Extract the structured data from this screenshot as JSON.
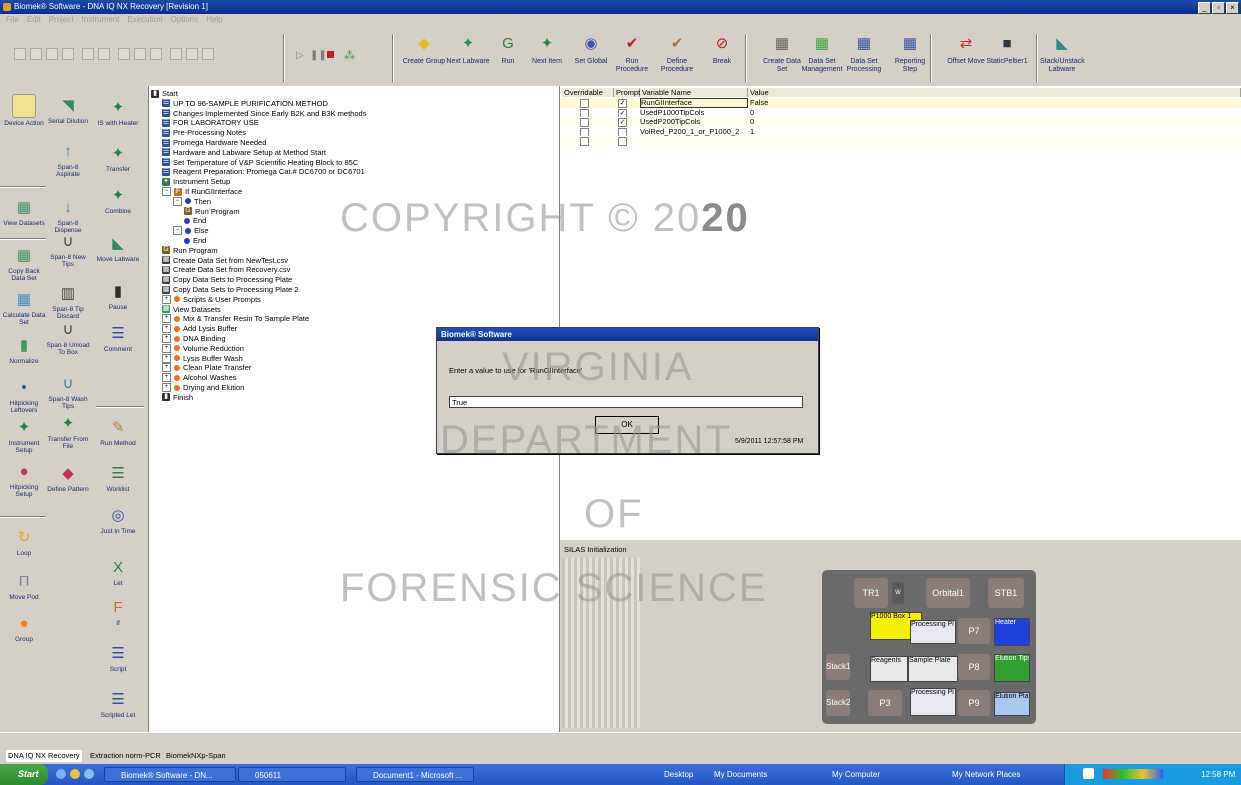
{
  "window": {
    "title": "Biomek® Software - DNA IQ NX Recovery [Revision 1]",
    "controls": [
      "_",
      "▫",
      "×"
    ]
  },
  "menu": [
    "File",
    "Edit",
    "Project",
    "Instrument",
    "Execution",
    "Options",
    "Help"
  ],
  "toolbar": {
    "buttons": [
      {
        "label": "Create Group",
        "icon": "create-group-icon",
        "color": "#e0c020"
      },
      {
        "label": "Next Labware",
        "icon": "next-labware-icon",
        "color": "#2c8a4a"
      },
      {
        "label": "Run",
        "icon": "run-icon",
        "color": "#2a8040"
      },
      {
        "label": "Next Item",
        "icon": "next-item-icon",
        "color": "#2a8040"
      },
      {
        "label": "Set Global",
        "icon": "set-global-icon",
        "color": "#4050b8"
      },
      {
        "label": "Run Procedure",
        "icon": "run-procedure-icon",
        "color": "#c02020"
      },
      {
        "label": "Define Procedure",
        "icon": "define-procedure-icon",
        "color": "#c07030"
      },
      {
        "label": "Break",
        "icon": "break-icon",
        "color": "#c02020"
      },
      {
        "label": "Create Data Set",
        "icon": "create-data-set-icon",
        "color": "#606060"
      },
      {
        "label": "Data Set Management",
        "icon": "data-set-management-icon",
        "color": "#40a040"
      },
      {
        "label": "Data Set Processing",
        "icon": "data-set-processing-icon",
        "color": "#3050a0"
      },
      {
        "label": "Reporting Step",
        "icon": "reporting-step-icon",
        "color": "#3050a0"
      },
      {
        "label": "Offset Move",
        "icon": "offset-move-icon",
        "color": "#d03020"
      },
      {
        "label": "StaticPeltier1",
        "icon": "static-peltier-icon",
        "color": "#303840"
      },
      {
        "label": "Stack/Unstack Labware",
        "icon": "stack-unstack-icon",
        "color": "#2a8a8a"
      }
    ]
  },
  "palette": {
    "col1": [
      {
        "label": "Device Action",
        "icon": "device-action-icon",
        "color": "#f0e090"
      },
      {
        "label": "View Datasets",
        "icon": "view-datasets-icon",
        "color": "#3a9a5a"
      },
      {
        "label": "Copy Back Data Set",
        "icon": "copy-back-icon",
        "color": "#3a9a5a"
      },
      {
        "label": "Calculate Data Set",
        "icon": "calculate-icon",
        "color": "#3a8ac0"
      },
      {
        "label": "Normalize",
        "icon": "normalize-icon",
        "color": "#3a9a5a"
      },
      {
        "label": "Hitpicking Leftovers",
        "icon": "hitpicking-leftovers-icon",
        "color": "#3050a0"
      },
      {
        "label": "Instrument Setup",
        "icon": "instrument-setup-icon",
        "color": "#2a8040"
      },
      {
        "label": "Hitpicking Setup",
        "icon": "hitpicking-setup-icon",
        "color": "#c03060"
      },
      {
        "label": "Loop",
        "icon": "loop-icon",
        "color": "#f0a020"
      },
      {
        "label": "Move Pod",
        "icon": "move-pod-icon",
        "color": "#8080a0"
      },
      {
        "label": "Group",
        "icon": "group-icon",
        "color": "#f08020"
      }
    ],
    "col2": [
      {
        "label": "Serial Dilution",
        "icon": "serial-dilution-icon",
        "color": "#2a8a6a"
      },
      {
        "label": "Span-8 Aspirate",
        "icon": "span8-aspirate-icon",
        "color": "#3a7aa0"
      },
      {
        "label": "Span-8 Dispense",
        "icon": "span8-dispense-icon",
        "color": "#3a7aa0"
      },
      {
        "label": "Span-8 New Tips",
        "icon": "span8-new-tips-icon",
        "color": "#404040"
      },
      {
        "label": "Span-8 Tip Discard",
        "icon": "span8-tip-discard-icon",
        "color": "#404040"
      },
      {
        "label": "Span-8 Unload To Box",
        "icon": "span8-unload-icon",
        "color": "#404040"
      },
      {
        "label": "Span-8 Wash Tips",
        "icon": "span8-wash-icon",
        "color": "#3a7aa0"
      },
      {
        "label": "Transfer From File",
        "icon": "transfer-from-file-icon",
        "color": "#2a8040"
      },
      {
        "label": "Define Pattern",
        "icon": "define-pattern-icon",
        "color": "#c03060"
      }
    ],
    "col3": [
      {
        "label": "IS with Heater",
        "icon": "is-heater-icon",
        "color": "#2a8040"
      },
      {
        "label": "Transfer",
        "icon": "transfer-icon",
        "color": "#2a8040"
      },
      {
        "label": "Combine",
        "icon": "combine-icon",
        "color": "#2a8040"
      },
      {
        "label": "Move Labware",
        "icon": "move-labware-icon",
        "color": "#2a8a6a"
      },
      {
        "label": "Pause",
        "icon": "pause-icon",
        "color": "#303030"
      },
      {
        "label": "Comment",
        "icon": "comment-icon",
        "color": "#3050a0"
      },
      {
        "label": "Run Method",
        "icon": "run-method-icon",
        "color": "#b08040"
      },
      {
        "label": "Worklist",
        "icon": "worklist-icon",
        "color": "#2a8040"
      },
      {
        "label": "Just In Time",
        "icon": "just-in-time-icon",
        "color": "#3050a0"
      },
      {
        "label": "Let",
        "icon": "let-icon",
        "color": "#2a8040"
      },
      {
        "label": "If",
        "icon": "if-icon",
        "color": "#c07030"
      },
      {
        "label": "Script",
        "icon": "script-icon",
        "color": "#3050a0"
      },
      {
        "label": "Scripted Let",
        "icon": "scripted-let-icon",
        "color": "#3050a0"
      }
    ]
  },
  "tree": [
    {
      "label": "Start",
      "indent": 0,
      "kind": "start"
    },
    {
      "label": "UP TO 96-SAMPLE PURIFICATION METHOD",
      "indent": 1,
      "kind": "comment"
    },
    {
      "label": "Changes Implemented Since Early B2K and B3K methods",
      "indent": 1,
      "kind": "comment"
    },
    {
      "label": "FOR LABORATORY USE",
      "indent": 1,
      "kind": "comment"
    },
    {
      "label": "Pre-Processing Notes",
      "indent": 1,
      "kind": "comment"
    },
    {
      "label": "Promega Hardware Needed",
      "indent": 1,
      "kind": "comment"
    },
    {
      "label": "Hardware and Labware Setup at Method Start",
      "indent": 1,
      "kind": "comment"
    },
    {
      "label": "Set Temperature of V&P Scientific Heating Block to 85C",
      "indent": 1,
      "kind": "comment"
    },
    {
      "label": "Reagent Preparation:  Promega Cat.# DC6700 or DC6701",
      "indent": 1,
      "kind": "comment"
    },
    {
      "label": "Instrument Setup",
      "indent": 1,
      "kind": "setup"
    },
    {
      "label": "If RunGIInterface",
      "indent": 1,
      "kind": "if"
    },
    {
      "label": "Then",
      "indent": 2,
      "kind": "branch"
    },
    {
      "label": "Run Program",
      "indent": 3,
      "kind": "run"
    },
    {
      "label": "End",
      "indent": 3,
      "kind": "end"
    },
    {
      "label": "Else",
      "indent": 2,
      "kind": "branch"
    },
    {
      "label": "End",
      "indent": 3,
      "kind": "end"
    },
    {
      "label": "Run Program",
      "indent": 1,
      "kind": "run"
    },
    {
      "label": "Create Data Set from NewTest.csv",
      "indent": 1,
      "kind": "data"
    },
    {
      "label": "Create Data Set from Recovery.csv",
      "indent": 1,
      "kind": "data"
    },
    {
      "label": "Copy Data Sets to Processing Plate",
      "indent": 1,
      "kind": "copy"
    },
    {
      "label": "Copy Data Sets to Processing Plate 2",
      "indent": 1,
      "kind": "copy"
    },
    {
      "label": "Scripts & User Prompts",
      "indent": 1,
      "kind": "group"
    },
    {
      "label": "View Datasets",
      "indent": 1,
      "kind": "view"
    },
    {
      "label": "Mix & Transfer Resin To Sample Plate",
      "indent": 1,
      "kind": "group"
    },
    {
      "label": "Add Lysis Buffer",
      "indent": 1,
      "kind": "group"
    },
    {
      "label": "DNA Binding",
      "indent": 1,
      "kind": "group"
    },
    {
      "label": "Volume Reduction",
      "indent": 1,
      "kind": "group"
    },
    {
      "label": "Lysis Buffer Wash",
      "indent": 1,
      "kind": "group"
    },
    {
      "label": "Clean Plate Transfer",
      "indent": 1,
      "kind": "group"
    },
    {
      "label": "Alcohol Washes",
      "indent": 1,
      "kind": "group"
    },
    {
      "label": "Drying and Elution",
      "indent": 1,
      "kind": "group"
    },
    {
      "label": "Finish",
      "indent": 1,
      "kind": "finish"
    }
  ],
  "variables": {
    "headers": [
      "Overridable",
      "Prompt",
      "Variable Name",
      "Value"
    ],
    "rows": [
      {
        "overridable": false,
        "prompt": true,
        "name": "RunGIInterface",
        "value": "False"
      },
      {
        "overridable": false,
        "prompt": true,
        "name": "UsedP1000TipCols",
        "value": "0"
      },
      {
        "overridable": false,
        "prompt": true,
        "name": "UsedP200TipCols",
        "value": "0"
      },
      {
        "overridable": false,
        "prompt": false,
        "name": "VolRed_P200_1_or_P1000_2",
        "value": "1"
      },
      {
        "overridable": false,
        "prompt": false,
        "name": "",
        "value": ""
      }
    ]
  },
  "deck": {
    "title": "SILAS Initialization",
    "positions": [
      "TR1",
      "Orbital1",
      "STB1",
      "P7",
      "P8",
      "P3",
      "P9",
      "Stack1",
      "Stack2"
    ],
    "labware": [
      "P1000 Box 1",
      "Processing Pl",
      "Heater",
      "Reagents",
      "Sample Plate",
      "Elution Tips",
      "Processing Pl",
      "Elution Plate"
    ],
    "misc": "W"
  },
  "dialog": {
    "title": "Biomek® Software",
    "prompt": "Enter a value to use for 'RunGIInterface'",
    "value": "True",
    "ok": "OK",
    "timestamp": "5/9/2011 12:57:58 PM"
  },
  "watermark": {
    "line1": "COPYRIGHT © 20",
    "line1b": "20",
    "line2": "VIRGINIA",
    "line3": "DEPARTMENT",
    "line4": "OF",
    "line5": "FORENSIC SCIENCE"
  },
  "tabs": [
    "DNA IQ NX Recovery",
    "Extraction norm-PCR",
    "BiomekNXp-Span"
  ],
  "taskbar": {
    "start": "Start",
    "tasks": [
      "Biomek® Software - DN...",
      "050611",
      "Document1 - Microsoft ..."
    ],
    "links": [
      "Desktop",
      "My Documents",
      "My Computer",
      "My Network Places"
    ],
    "clock": "12:58 PM"
  }
}
